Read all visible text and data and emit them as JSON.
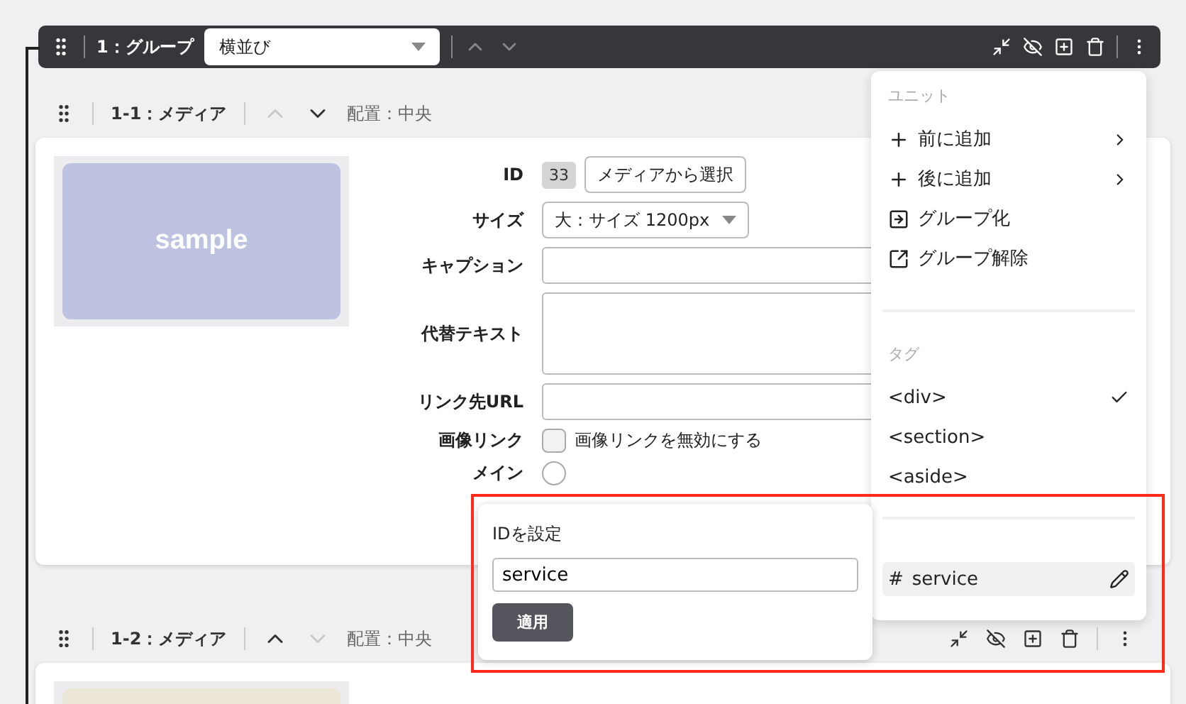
{
  "group": {
    "title": "1：グループ",
    "layout_select": "横並び",
    "up_disabled": true,
    "down_disabled": true
  },
  "units": [
    {
      "title": "1-1：メディア",
      "up_disabled": true,
      "down_disabled": false,
      "alignment": "配置：中央",
      "actions_visible": false,
      "image": {
        "color": "#bcc2e0",
        "text": "sample"
      },
      "fields": [
        {
          "kind": "id",
          "label": "ID",
          "badge": "33",
          "button": "メディアから選択"
        },
        {
          "kind": "select",
          "label": "サイズ",
          "value": "大：サイズ 1200px"
        },
        {
          "kind": "text",
          "label": "キャプション"
        },
        {
          "kind": "textarea",
          "label": "代替テキスト"
        },
        {
          "kind": "text",
          "label": "リンク先URL"
        },
        {
          "kind": "checkbox",
          "label": "画像リンク",
          "option": "画像リンクを無効にする",
          "checked": false
        },
        {
          "kind": "radio",
          "label": "メイン",
          "selected": false
        }
      ]
    },
    {
      "title": "1-2：メディア",
      "up_disabled": false,
      "down_disabled": true,
      "alignment": "配置：中央",
      "actions_visible": true,
      "image": {
        "color": "#ebe6d6"
      }
    }
  ],
  "menu": {
    "unit_heading": "ユニット",
    "unit_items": [
      {
        "kind": "add",
        "label": "前に追加"
      },
      {
        "kind": "add",
        "label": "後に追加"
      },
      {
        "kind": "group",
        "label": "グループ化"
      },
      {
        "kind": "ungroup",
        "label": "グループ解除"
      }
    ],
    "tag_heading": "タグ",
    "tags": [
      {
        "label": "<div>",
        "selected": true
      },
      {
        "label": "<section>",
        "selected": false
      },
      {
        "label": "<aside>",
        "selected": false
      }
    ],
    "id_item": {
      "hash": "#",
      "value": "service"
    }
  },
  "id_popover": {
    "title": "IDを設定",
    "value": "service",
    "button": "適用"
  }
}
